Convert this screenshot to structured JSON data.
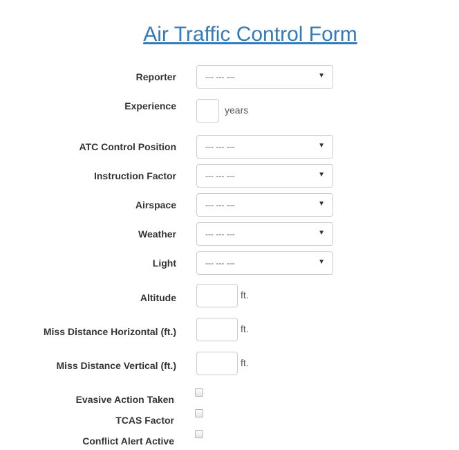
{
  "title": "Air Traffic Control Form",
  "fields": {
    "reporter": {
      "label": "Reporter",
      "value": "--- --- ---"
    },
    "experience": {
      "label": "Experience",
      "value": "",
      "unit": "years"
    },
    "atc_control_position": {
      "label": "ATC Control Position",
      "value": "--- --- ---"
    },
    "instruction_factor": {
      "label": "Instruction Factor",
      "value": "--- --- ---"
    },
    "airspace": {
      "label": "Airspace",
      "value": "--- --- ---"
    },
    "weather": {
      "label": "Weather",
      "value": "--- --- ---"
    },
    "light": {
      "label": "Light",
      "value": "--- --- ---"
    },
    "altitude": {
      "label": "Altitude",
      "value": "",
      "unit": "ft."
    },
    "miss_distance_horizontal": {
      "label": "Miss Distance Horizontal (ft.)",
      "value": "",
      "unit": "ft."
    },
    "miss_distance_vertical": {
      "label": "Miss Distance Vertical (ft.)",
      "value": "",
      "unit": "ft."
    },
    "evasive_action_taken": {
      "label": "Evasive Action Taken",
      "checked": false
    },
    "tcas_factor": {
      "label": "TCAS Factor",
      "checked": false
    },
    "conflict_alert_active": {
      "label": "Conflict Alert Active",
      "checked": false
    }
  },
  "icons": {
    "caret": "▼"
  }
}
